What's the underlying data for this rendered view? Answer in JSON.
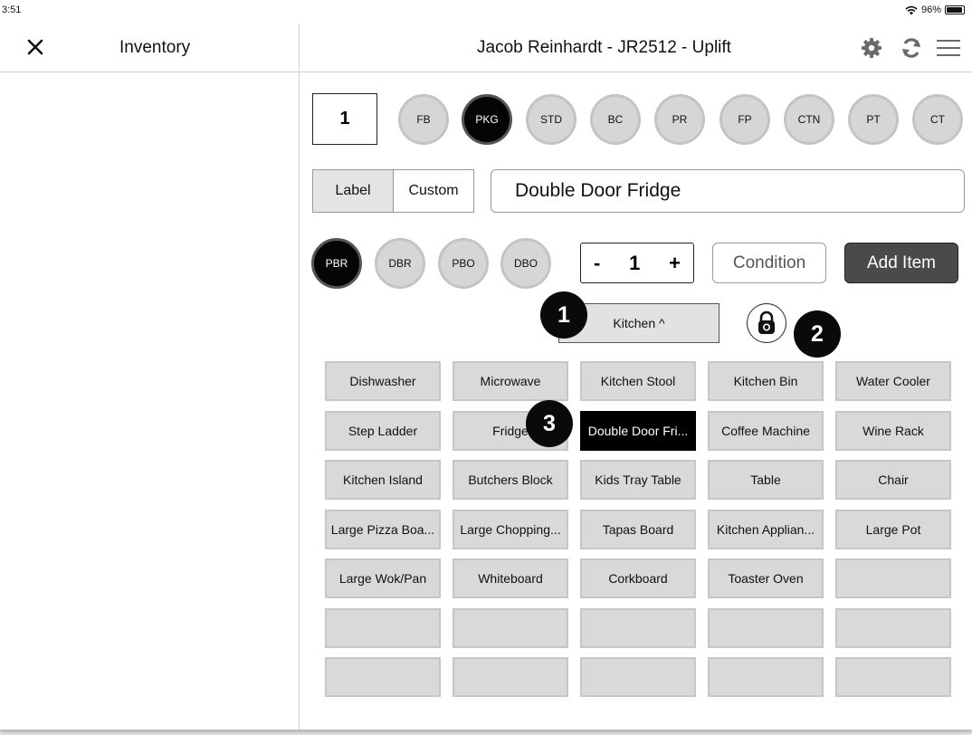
{
  "status_bar": {
    "time": "3:51",
    "battery": "96%",
    "battery_level": 0.96
  },
  "sidebar": {
    "title": "Inventory"
  },
  "header": {
    "title": "Jacob Reinhardt - JR2512 - Uplift"
  },
  "quantity_box": "1",
  "packing_codes": [
    "FB",
    "PKG",
    "STD",
    "BC",
    "PR",
    "FP",
    "CTN",
    "PT",
    "CT"
  ],
  "active_packing_code": "PKG",
  "label_mode": {
    "options": [
      "Label",
      "Custom"
    ],
    "selected": "Label"
  },
  "item_name_value": "Double Door Fridge",
  "condition_codes": [
    "PBR",
    "DBR",
    "PBO",
    "DBO"
  ],
  "active_condition_code": "PBR",
  "stepper": {
    "minus": "-",
    "value": "1",
    "plus": "+"
  },
  "condition_button": "Condition",
  "add_item_button": "Add Item",
  "room_selector": "Kitchen  ^",
  "callouts": [
    "1",
    "2",
    "3"
  ],
  "item_grid": [
    [
      "Dishwasher",
      "Microwave",
      "Kitchen Stool",
      "Kitchen Bin",
      "Water Cooler"
    ],
    [
      "Step Ladder",
      "Fridge",
      "Double Door Fri...",
      "Coffee Machine",
      "Wine Rack"
    ],
    [
      "Kitchen Island",
      "Butchers Block",
      "Kids Tray Table",
      "Table",
      "Chair"
    ],
    [
      "Large Pizza Boa...",
      "Large Chopping...",
      "Tapas Board",
      "Kitchen Applian...",
      "Large Pot"
    ],
    [
      "Large Wok/Pan",
      "Whiteboard",
      "Corkboard",
      "Toaster Oven",
      ""
    ],
    [
      "",
      "",
      "",
      "",
      ""
    ],
    [
      "",
      "",
      "",
      "",
      ""
    ]
  ],
  "selected_item": "Double Door Fri..."
}
